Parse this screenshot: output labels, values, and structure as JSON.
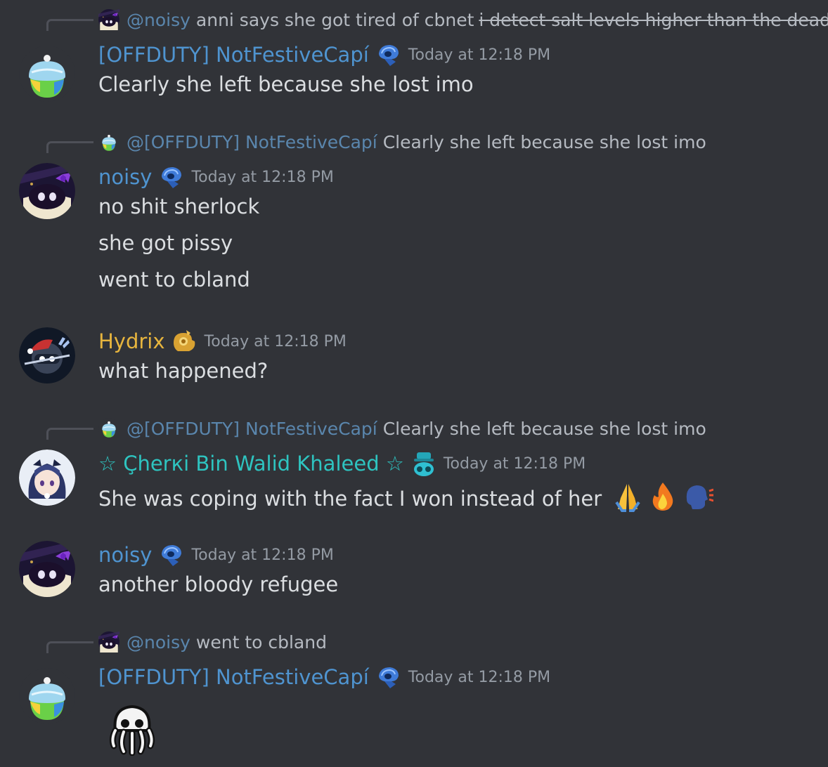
{
  "messages": [
    {
      "reply": {
        "mention": "@noisy",
        "text": "anni says she got tired of cbnet",
        "strike": "i detect salt levels higher than the dead sea"
      },
      "author": "[OFFDUTY] NotFestiveCapí",
      "author_color": "#4f94d0",
      "timestamp": "Today at 12:18 PM",
      "lines": [
        "Clearly she left because she lost imo"
      ]
    },
    {
      "reply": {
        "mention": "@[OFFDUTY] NotFestiveCapí",
        "text": "Clearly she left because she lost imo"
      },
      "author": "noisy",
      "author_color": "#4f94d0",
      "timestamp": "Today at 12:18 PM",
      "lines": [
        "no shit sherlock",
        "she got pissy",
        "went to cbland"
      ]
    },
    {
      "author": "Hydrix",
      "author_color": "#e7b53e",
      "timestamp": "Today at 12:18 PM",
      "lines": [
        "what happened?"
      ]
    },
    {
      "reply": {
        "mention": "@[OFFDUTY] NotFestiveCapí",
        "text": "Clearly she left because she lost imo"
      },
      "author": "☆ Çherкi Bin Walid Khaleed ☆",
      "author_color": "#2ec4c0",
      "timestamp": "Today at 12:18 PM",
      "lines": [
        "She was coping with the fact I won instead of her"
      ],
      "emojis": [
        "folded-hands",
        "fire",
        "speaking-head"
      ]
    },
    {
      "author": "noisy",
      "author_color": "#4f94d0",
      "timestamp": "Today at 12:18 PM",
      "lines": [
        "another bloody refugee"
      ]
    },
    {
      "reply": {
        "mention": "@noisy",
        "text": "went to cbland"
      },
      "author": "[OFFDUTY] NotFestiveCapí",
      "author_color": "#4f94d0",
      "timestamp": "Today at 12:18 PM",
      "big_emoji": "octopus-ghost"
    }
  ],
  "colors": {
    "background": "#313338",
    "text": "#dbdee1",
    "muted": "#949ba4",
    "mention": "#5a86ad"
  }
}
